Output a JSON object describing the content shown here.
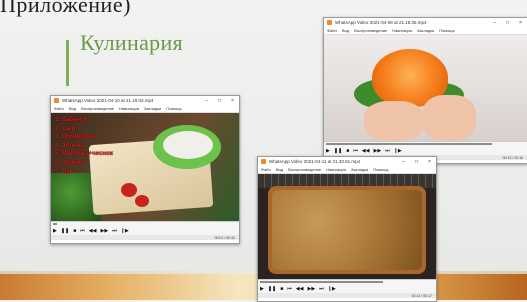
{
  "top_caption": "Приложение)",
  "slide": {
    "title": "Кулинария"
  },
  "menu": [
    "Файл",
    "Вид",
    "Воспроизведение",
    "Навигация",
    "Закладки",
    "Помощь"
  ],
  "windows": [
    {
      "title": "WhatsApp Video 2021-04-10 at 21.19.03.mp4",
      "recipe_lines": [
        "1. Кабачок",
        "2. Сыр",
        "3. Помидоры",
        "4. Зелень",
        "5. Майонез+чеснок",
        "6. Зелень",
        "7. Лук"
      ],
      "status": "00:01 / 00:42",
      "progress": 0.02
    },
    {
      "title": "WhatsApp Video 2021-04-08 at 21.18.05.mp4",
      "status": "00:13 / 00:16",
      "progress": 0.85
    },
    {
      "title": "WhatsApp Video 2021-04-11 at 21.33.51.mp4",
      "status": "00:12 / 00:17",
      "progress": 0.72
    }
  ],
  "controls": [
    "▶",
    "❚❚",
    "■",
    "⏮",
    "◀◀",
    "▶▶",
    "⏭",
    "❙▶"
  ]
}
